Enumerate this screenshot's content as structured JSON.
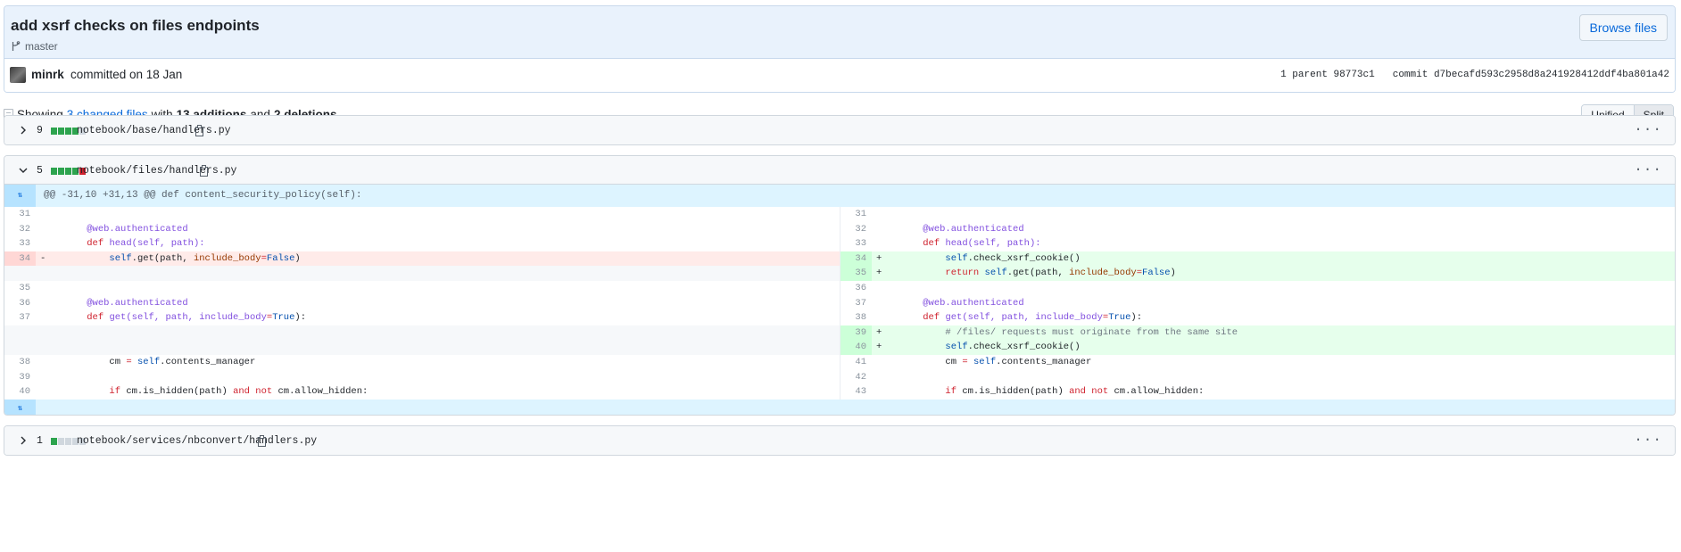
{
  "commit": {
    "title": "add xsrf checks on files endpoints",
    "branch": "master",
    "browse_label": "Browse files",
    "author": "minrk",
    "committed_text": "committed on 18 Jan",
    "parent_text": "1 parent 98773c1",
    "commit_text": "commit d7becafd593c2958d8a241928412ddf4ba801a42"
  },
  "toc": {
    "showing": "Showing",
    "changed_files": "3 changed files",
    "with": "with",
    "additions": "13 additions",
    "and": "and",
    "deletions": "2 deletions",
    "period": "."
  },
  "view_toggle": {
    "unified": "Unified",
    "split": "Split"
  },
  "files": [
    {
      "count": "9",
      "name": "notebook/base/handlers.py",
      "bars": [
        "g",
        "g",
        "g",
        "g",
        "n"
      ]
    },
    {
      "count": "5",
      "name": "notebook/files/handlers.py",
      "bars": [
        "g",
        "g",
        "g",
        "g",
        "r"
      ]
    },
    {
      "count": "1",
      "name": "notebook/services/nbconvert/handlers.py",
      "bars": [
        "g",
        "n",
        "n",
        "n",
        "n"
      ]
    }
  ],
  "hunk": {
    "header": "@@ -31,10 +31,13 @@ def content_security_policy(self):"
  },
  "diff_lines": {
    "l31": "31",
    "l32": "32",
    "l33": "33",
    "l34": "34",
    "l35": "35",
    "l36": "36",
    "l37": "37",
    "l38": "38",
    "l39": "39",
    "l40": "40",
    "r31": "31",
    "r32": "32",
    "r33": "33",
    "r34": "34",
    "r35": "35",
    "r36": "36",
    "r37": "37",
    "r38": "38",
    "r39": "39",
    "r40": "40",
    "r41": "41",
    "r42": "42",
    "r43": "43",
    "minus": "-",
    "plus": "+"
  },
  "code": {
    "decorator": "@web.authenticated",
    "def": "def",
    "head_sig": "head(self, path):",
    "self": "self",
    "get_call_a": ".get(path, ",
    "include_body": "include_body",
    "eq": "=",
    "false": "False",
    "close_paren": ")",
    "check_xsrf": ".check_xsrf_cookie()",
    "return": "return",
    "get_sig_a": "get(self, path, include_body",
    "true": "True",
    "get_sig_b": "):",
    "comment": "# /files/ requests must originate from the same site",
    "cm_a": "cm ",
    "cm_eq": "=",
    "cm_b": ".contents_manager",
    "if": "if",
    "hidden_a": " cm.is_hidden(path) ",
    "and": "and",
    "not": "not",
    "hidden_b": " cm.allow_hidden:"
  },
  "colors": {
    "accent": "#0969da",
    "add": "#2da44e",
    "del": "#cf222e"
  },
  "icons": [
    "branch-icon",
    "chevron-right-icon",
    "chevron-down-icon",
    "clipboard-icon",
    "kebab-icon",
    "expand-icon"
  ]
}
